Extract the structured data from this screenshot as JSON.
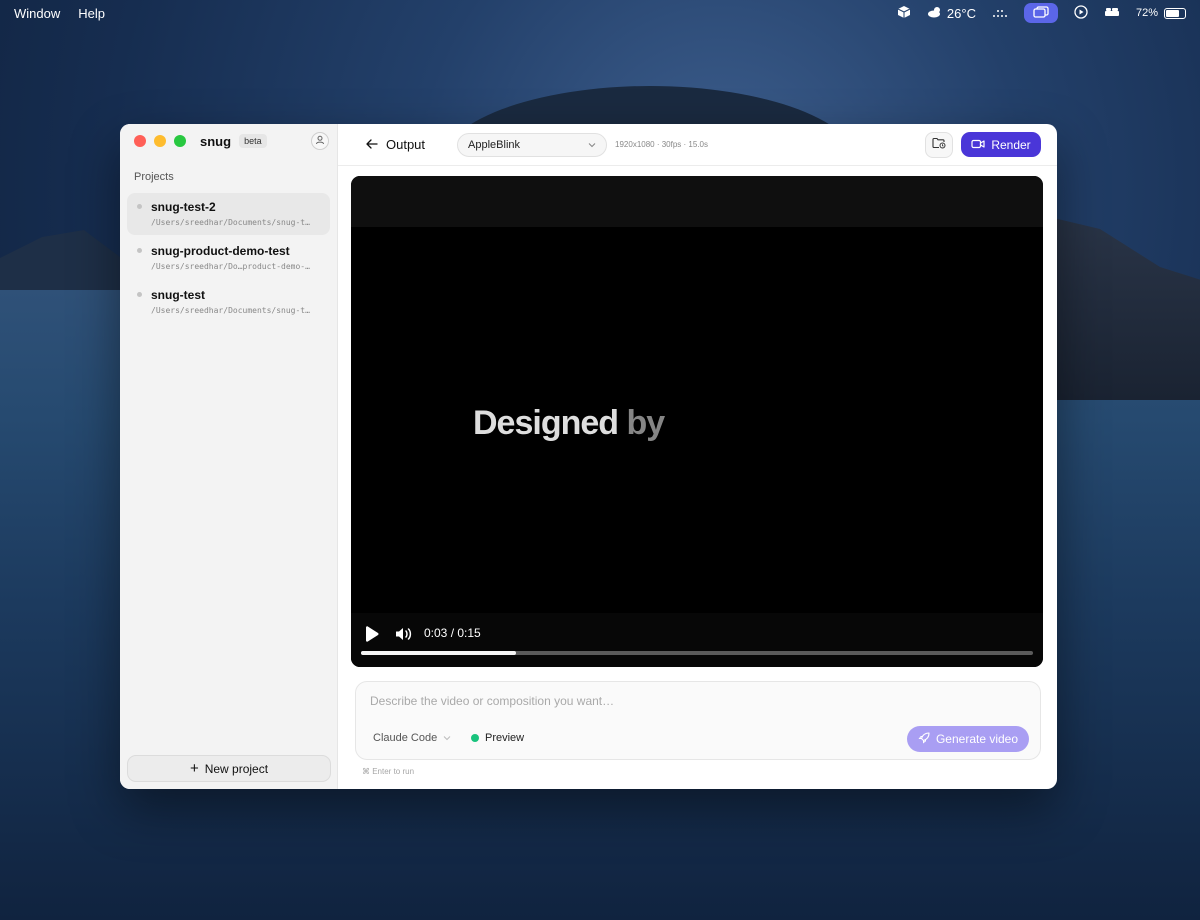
{
  "menubar": {
    "menus": [
      "Window",
      "Help"
    ],
    "weather": "26°C",
    "battery": "72%",
    "battery_level": 0.72
  },
  "app": {
    "name": "snug",
    "badge": "beta"
  },
  "sidebar": {
    "section_label": "Projects",
    "projects": [
      {
        "name": "snug-test-2",
        "path": "/Users/sreedhar/Documents/snug-t…"
      },
      {
        "name": "snug-product-demo-test",
        "path": "/Users/sreedhar/Do…product-demo-…"
      },
      {
        "name": "snug-test",
        "path": "/Users/sreedhar/Documents/snug-t…"
      }
    ],
    "new_project_label": "New project"
  },
  "toolbar": {
    "back_label": "Output",
    "composition": "AppleBlink",
    "meta": "1920x1080 · 30fps · 15.0s",
    "render_label": "Render"
  },
  "player": {
    "caption_main": "Designed",
    "caption_accent": "by",
    "time": "0:03 / 0:15",
    "progress": 0.23
  },
  "prompt": {
    "placeholder": "Describe the video or composition you want…",
    "model": "Claude Code",
    "mode": "Preview",
    "generate_label": "Generate video",
    "hint": "⌘ Enter to run"
  },
  "colors": {
    "accent": "#4a36d8",
    "accent_light": "#a99ef3",
    "status_green": "#19c37d"
  }
}
